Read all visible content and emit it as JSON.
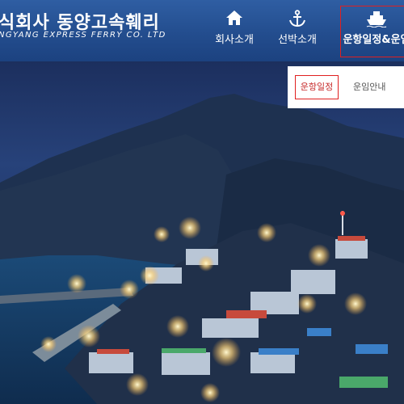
{
  "logo": {
    "main": "식회사 동양고속훼리",
    "sub": "NGYANG EXPRESS FERRY CO. LTD"
  },
  "nav": {
    "company": "회사소개",
    "vessel": "선박소개",
    "schedule": "운항일정&운임"
  },
  "submenu": {
    "schedule": "운항일정",
    "fare": "운임안내"
  },
  "colors": {
    "header": "#2a5699",
    "highlight": "#e02020"
  },
  "icons": {
    "company": "home-icon",
    "vessel": "anchor-icon",
    "schedule": "ship-icon"
  }
}
